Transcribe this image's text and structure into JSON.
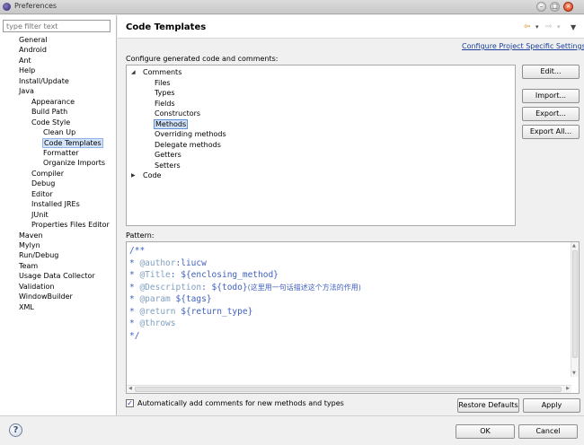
{
  "window": {
    "title": "Preferences"
  },
  "filter": {
    "placeholder": "type filter text"
  },
  "sidebar": {
    "items": [
      {
        "label": "General",
        "depth": 0
      },
      {
        "label": "Android",
        "depth": 0
      },
      {
        "label": "Ant",
        "depth": 0
      },
      {
        "label": "Help",
        "depth": 0
      },
      {
        "label": "Install/Update",
        "depth": 0
      },
      {
        "label": "Java",
        "depth": 0
      },
      {
        "label": "Appearance",
        "depth": 1
      },
      {
        "label": "Build Path",
        "depth": 1
      },
      {
        "label": "Code Style",
        "depth": 1
      },
      {
        "label": "Clean Up",
        "depth": 2
      },
      {
        "label": "Code Templates",
        "depth": 2,
        "selected": true
      },
      {
        "label": "Formatter",
        "depth": 2
      },
      {
        "label": "Organize Imports",
        "depth": 2
      },
      {
        "label": "Compiler",
        "depth": 1
      },
      {
        "label": "Debug",
        "depth": 1
      },
      {
        "label": "Editor",
        "depth": 1
      },
      {
        "label": "Installed JREs",
        "depth": 1
      },
      {
        "label": "JUnit",
        "depth": 1
      },
      {
        "label": "Properties Files Editor",
        "depth": 1
      },
      {
        "label": "Maven",
        "depth": 0
      },
      {
        "label": "Mylyn",
        "depth": 0
      },
      {
        "label": "Run/Debug",
        "depth": 0
      },
      {
        "label": "Team",
        "depth": 0
      },
      {
        "label": "Usage Data Collector",
        "depth": 0
      },
      {
        "label": "Validation",
        "depth": 0
      },
      {
        "label": "WindowBuilder",
        "depth": 0
      },
      {
        "label": "XML",
        "depth": 0
      }
    ]
  },
  "page": {
    "title": "Code Templates",
    "configure_link": "Configure Project Specific Settings...",
    "config_label": "Configure generated code and comments:",
    "pattern_label": "Pattern:",
    "auto_comments_label": "Automatically add comments for new methods and types",
    "auto_comments_checked": true
  },
  "templates_tree": [
    {
      "label": "Comments",
      "depth": 0,
      "twisty": "expanded"
    },
    {
      "label": "Files",
      "depth": 1
    },
    {
      "label": "Types",
      "depth": 1
    },
    {
      "label": "Fields",
      "depth": 1
    },
    {
      "label": "Constructors",
      "depth": 1
    },
    {
      "label": "Methods",
      "depth": 1,
      "selected": true
    },
    {
      "label": "Overriding methods",
      "depth": 1
    },
    {
      "label": "Delegate methods",
      "depth": 1
    },
    {
      "label": "Getters",
      "depth": 1
    },
    {
      "label": "Setters",
      "depth": 1
    },
    {
      "label": "Code",
      "depth": 0,
      "twisty": "collapsed"
    }
  ],
  "pattern_lines": [
    [
      {
        "t": "/**"
      }
    ],
    [
      {
        "t": "* "
      },
      {
        "t": "@author",
        "tag": true
      },
      {
        "t": ":liucw"
      }
    ],
    [
      {
        "t": "* "
      },
      {
        "t": "@Title",
        "tag": true
      },
      {
        "t": ": ${enclosing_method}"
      }
    ],
    [
      {
        "t": "* "
      },
      {
        "t": "@Description",
        "tag": true
      },
      {
        "t": ": ${todo}"
      },
      {
        "t": "(这里用一句话描述这个方法的作用)",
        "cn": true
      }
    ],
    [
      {
        "t": "* "
      },
      {
        "t": "@param",
        "tag": true
      },
      {
        "t": " ${tags}"
      }
    ],
    [
      {
        "t": "* "
      },
      {
        "t": "@return",
        "tag": true
      },
      {
        "t": " ${return_type}"
      }
    ],
    [
      {
        "t": "* "
      },
      {
        "t": "@throws",
        "tag": true
      }
    ],
    [
      {
        "t": "*/"
      }
    ]
  ],
  "buttons": {
    "edit": "Edit...",
    "import": "Import...",
    "export": "Export...",
    "export_all": "Export All...",
    "restore_defaults": "Restore Defaults",
    "apply": "Apply",
    "ok": "OK",
    "cancel": "Cancel"
  },
  "icons": {
    "help": "?",
    "back": "⇦",
    "forward": "⇨",
    "dropdown": "▾",
    "view_menu": "▼",
    "minimize": "–",
    "maximize": "□",
    "close": "×",
    "check": "✓",
    "expanded": "◢",
    "collapsed": "▶"
  }
}
